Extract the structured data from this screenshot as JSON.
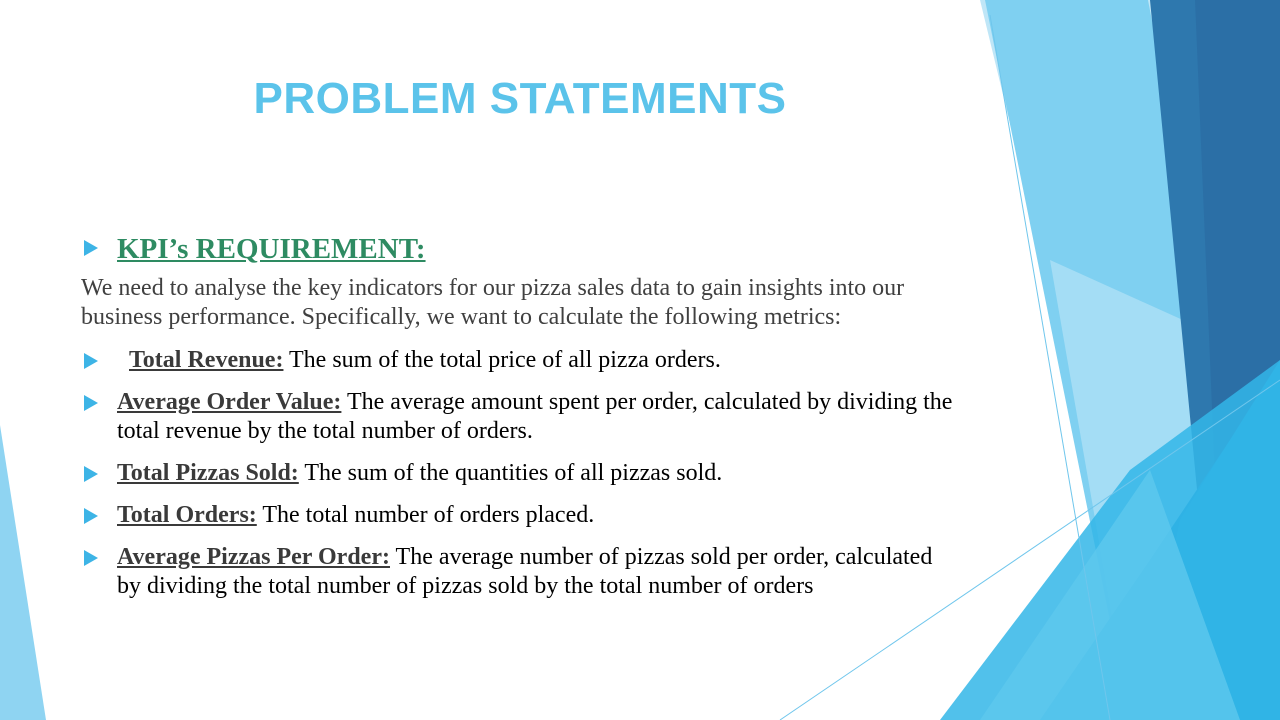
{
  "slide": {
    "title": "PROBLEM STATEMENTS",
    "section_heading": "KPI’s REQUIREMENT:",
    "intro": "We need to analyse the key indicators for our pizza sales data to gain insights into our business performance. Specifically, we want to calculate the following metrics:",
    "items": [
      {
        "label": "Total Revenue:",
        "text": " The sum of the total price of all pizza orders."
      },
      {
        "label": "Average Order Value:",
        "text": " The average amount spent per order, calculated by dividing the total revenue by the total number of orders."
      },
      {
        "label": "Total Pizzas Sold:",
        "text": " The sum of the quantities of all pizzas sold."
      },
      {
        "label": "Total Orders:",
        "text": " The total number of orders placed."
      },
      {
        "label": "Average Pizzas Per Order:",
        "text": " The average number of pizzas sold per order, calculated by dividing the total number of pizzas sold by the total number of orders"
      }
    ]
  },
  "colors": {
    "title": "#5BC3EA",
    "heading": "#2E8B62",
    "bullet": "#3DB4E6",
    "label": "#3A3A3A",
    "body": "#000000",
    "intro": "#404040"
  },
  "icons": {
    "bullet": "triangle-bullet-icon"
  }
}
